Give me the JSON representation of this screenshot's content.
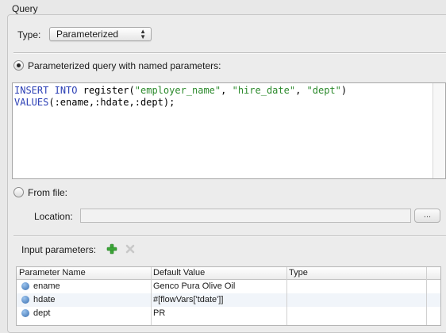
{
  "section_title": "Query",
  "type": {
    "label": "Type:",
    "value": "Parameterized"
  },
  "options": {
    "parameterized_label": "Parameterized query with named parameters:",
    "from_file_label": "From file:"
  },
  "editor": {
    "line1": {
      "kw1": "INSERT",
      "kw2": "INTO",
      "name": "register(",
      "s1": "\"employer_name\"",
      "c1": ", ",
      "s2": "\"hire_date\"",
      "c2": ", ",
      "s3": "\"dept\"",
      "close": ")"
    },
    "line2": {
      "kw": "VALUES",
      "rest": "(:ename,:hdate,:dept);"
    }
  },
  "location": {
    "label": "Location:",
    "value": "",
    "browse_label": "..."
  },
  "input_params": {
    "label": "Input parameters:"
  },
  "table": {
    "headers": [
      "Parameter Name",
      "Default Value",
      "Type"
    ],
    "rows": [
      {
        "name": "ename",
        "default": "Genco Pura Olive Oil",
        "type": ""
      },
      {
        "name": "hdate",
        "default": "#[flowVars['tdate']]",
        "type": ""
      },
      {
        "name": "dept",
        "default": "PR",
        "type": ""
      }
    ]
  },
  "colors": {
    "keyword": "#2b3fb5",
    "string": "#2c8a2c",
    "add_icon": "#3aa637",
    "remove_icon": "#c8c8c8"
  }
}
